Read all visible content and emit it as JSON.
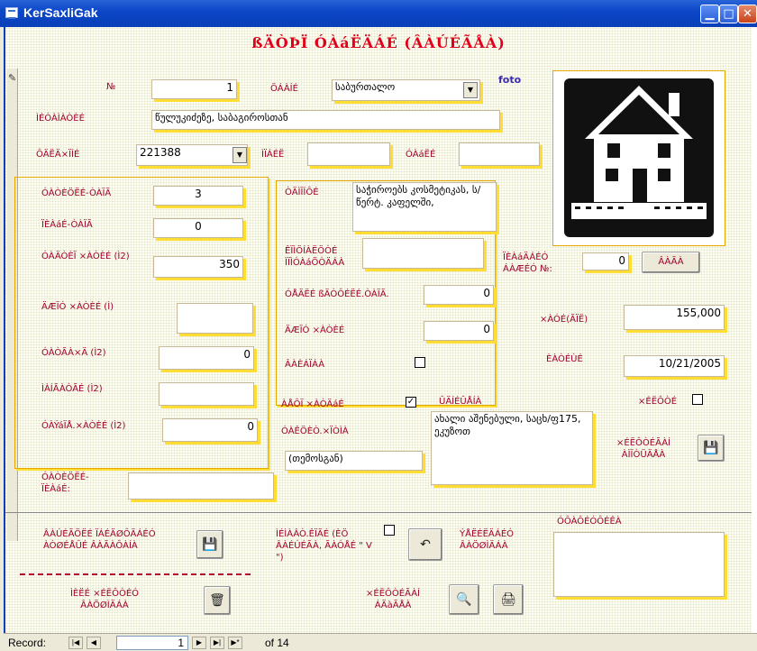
{
  "window": {
    "title": "KerSaxliGak"
  },
  "form": {
    "heading": "ßÄÒÞÏ ÓÀáËÄÁÉ (ÂÀÚÉÃÅÀ)",
    "foto_label": "foto",
    "labels": {
      "num": "№",
      "ubani": "ÖÁÀÍÉ",
      "misamarti": "ÌÉÓÀÌÀÒÈÉ",
      "telefoni": "ÔÄËÄ×ÏÍÉ",
      "mobil": "ÌÏÁÉË",
      "saxli": "ÓÀáËÉ",
      "sartulrao": "ÓÀÒÈÖËÉ-ÒÀÏÃ",
      "otaxrao": "ÏÈÀáÉ-ÒÀÏÃ",
      "saerto_farti": "ÓÀÄÒÈÏ ×ÀÒÈÉ (Ì2)",
      "ezos_farti": "ÄÆÏÓ ×ÀÒÈÉ (Ì)",
      "ferdazi": "ÓÀÒÃÀ×Ä (Ì2)",
      "sacxovrebeli": "ÌÀÍÃÀÒÃÉ (Ì2)",
      "saxl_farti": "ÓÀÝáÏÅ.×ÀÒÈÉ (Ì2)",
      "remonti": "ÒÄÌÏÍÔÉ",
      "komunaluri": "ÊÏÌÖÍÀËÖÒÉ ÌÏÌÓÀáÖÒÄÁÀ",
      "otaxebis_bazis": "ÏÈÀáÄÁÉÓ ÁÀÆÉÓ №:",
      "sveli_wertil": "ÓÅÄËÉ ßÄÒÔÉËÉ.ÒÀÏÃ.",
      "fasi_dol": "×ÀÓÉ(ÃÏË)",
      "ezos_farti2": "ÄÆÏÓ ×ÀÒÈÉ",
      "gatboba": "ÂÀÈÁÏÁÀ",
      "tarigi": "ÈÀÒÉÙÉ",
      "avto_farexi": "ÀÅÔÏ ×ÀÒÄáÉ",
      "shenishvna": "ÛÄÍÉÛÅÍÀ",
      "filtri": "×ÉËÔÒÉ",
      "sakutr_forma": "ÓÀÊÖÈÒ.×ÏÒÌÀ",
      "filtridan_amorcheva": "×ÉËÔÒÉÃÀÍ ÀÌÏÒÜÄÅÀ",
      "sartuli_otaxi": "ÓÀÒÈÖËÉ-ÏÈÀáÉ:",
      "gayiduli": "ÂÀÚÉÃÖËÉ ÏÁÉÄØÔÄÁÉÓ ÀÒØÉÅÛÉ ÂÀÃÀÔÀÍÀ",
      "mimagr_kodi": "ÌÉÌÀÂÒ.ÊÏÃÉ (ÈÖ ÂÀÉÚÉÃÀ, ÃÀÓÅÉ \" V \")",
      "cvlilebis_gauqmeba": "ÝÅËÉËÄÁÉÓ ÂÀÖØÌÄÁÀ",
      "statistika": "ÓÔÀÔÉÓÔÉÊÀ",
      "jgufi_filtris": "ÌÈËÉ ×ÉËÔÒÉÓ ÂÀÖØÌÄÁÀ",
      "filtridan_bechdva": "×ÉËÔÒÉÃÀÍ ÁÄàÃÅÀ"
    },
    "values": {
      "num": "1",
      "ubani": "საბურთალო",
      "misamarti": "წულუკიძეზე, საბაგიროსთან",
      "telefoni": "221388",
      "mobil": "",
      "saxli": "",
      "sartulrao": "3",
      "otaxrao": "0",
      "saerto_farti": "350",
      "ezos_farti": "",
      "ferdazi": "0",
      "sacxovrebeli": "",
      "saxl_farti": "0",
      "remonti": "საჭიროებს კოსმეტიკას, ს/წერტ. კაფელში,",
      "komunaluri": "",
      "otaxebis_bazis": "0",
      "sveli_wertil": "0",
      "ezos_farti2": "0",
      "fasi": "155,000",
      "tarigi": "10/21/2005",
      "shenishvna": "ახალი აშენებული, საცხ/ფ175, ეკუზოთ",
      "sakutr_forma": "(თემოსგან)",
      "sartuli_otaxi": "",
      "statistika": ""
    },
    "checks": {
      "gatboba": false,
      "avto_farexi": true,
      "filtri": false,
      "mimagr_kodi": false
    },
    "button_labels": {
      "gamba": "ÂÀÃÀ"
    }
  },
  "navigation": {
    "record_label": "Record:",
    "current": "1",
    "of_label": "of 14"
  },
  "icons": {
    "first": "first-record-icon",
    "prev": "prev-record-icon",
    "next": "next-record-icon",
    "last": "last-record-icon",
    "new": "new-record-icon"
  }
}
